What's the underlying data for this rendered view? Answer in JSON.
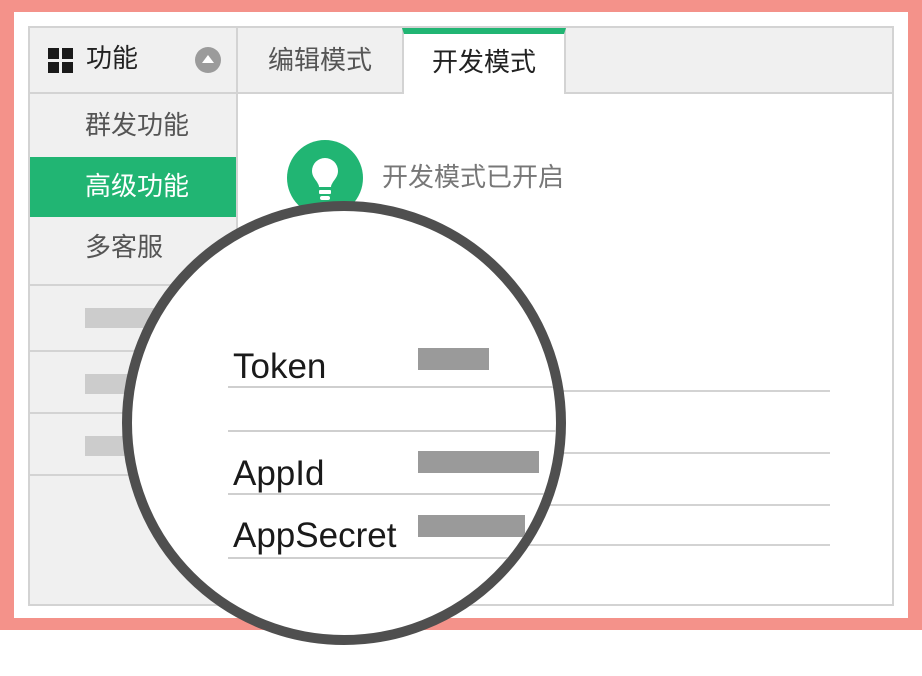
{
  "sidebar": {
    "title": "功能",
    "items": [
      {
        "label": "群发功能"
      },
      {
        "label": "高级功能"
      },
      {
        "label": "多客服"
      }
    ]
  },
  "tabs": [
    {
      "label": "编辑模式"
    },
    {
      "label": "开发模式"
    }
  ],
  "status": {
    "text": "开发模式已开启"
  },
  "fields": [
    {
      "label": "Token"
    },
    {
      "label": "AppId"
    },
    {
      "label": "AppSecret"
    }
  ],
  "colors": {
    "accent": "#21b573",
    "frame": "#f4928a"
  }
}
